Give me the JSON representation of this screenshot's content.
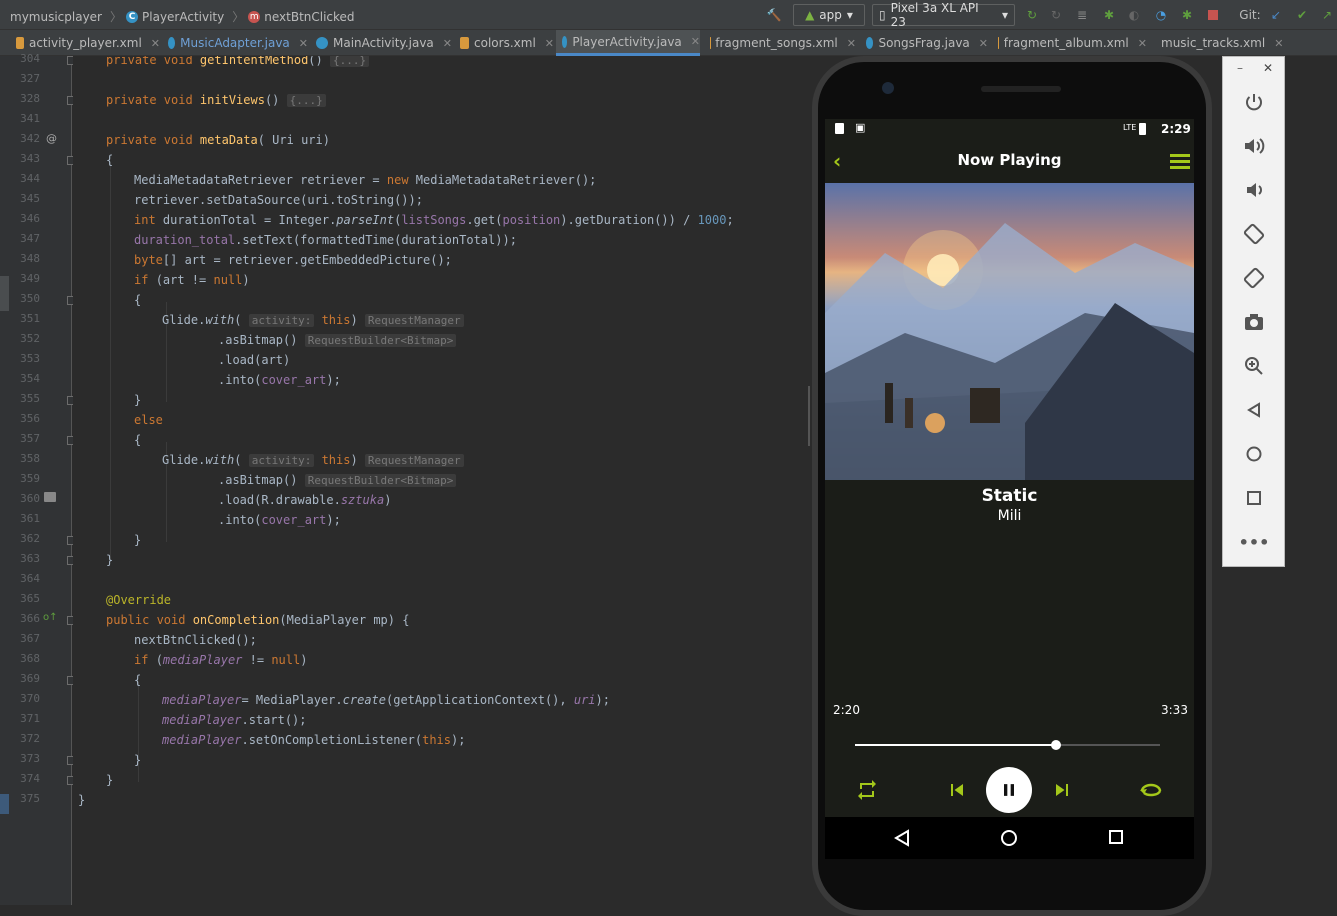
{
  "breadcrumb": {
    "project": "mymusicplayer",
    "class": "PlayerActivity",
    "method": "nextBtnClicked"
  },
  "toolbar": {
    "run_config": "app",
    "device": "Pixel 3a XL API 23",
    "git_label": "Git:"
  },
  "tabs": [
    {
      "label": "activity_player.xml",
      "type": "xml"
    },
    {
      "label": "MusicAdapter.java",
      "type": "java"
    },
    {
      "label": "MainActivity.java",
      "type": "java"
    },
    {
      "label": "colors.xml",
      "type": "xml"
    },
    {
      "label": "PlayerActivity.java",
      "type": "java",
      "active": true
    },
    {
      "label": "fragment_songs.xml",
      "type": "xml"
    },
    {
      "label": "SongsFrag.java",
      "type": "java"
    },
    {
      "label": "fragment_album.xml",
      "type": "xml"
    },
    {
      "label": "music_tracks.xml",
      "type": "xml"
    }
  ],
  "line_numbers": [
    "304",
    "327",
    "328",
    "341",
    "342",
    "343",
    "344",
    "345",
    "346",
    "347",
    "348",
    "349",
    "350",
    "351",
    "352",
    "353",
    "354",
    "355",
    "356",
    "357",
    "358",
    "359",
    "360",
    "361",
    "362",
    "363",
    "364",
    "365",
    "366",
    "367",
    "368",
    "369",
    "370",
    "371",
    "372",
    "373",
    "374",
    "375"
  ],
  "code_lines": [
    "private void getIntentMethod() {...}",
    "",
    "private void initViews() {...}",
    "",
    "private void metaData( Uri uri)",
    "{",
    "MediaMetadataRetriever retriever = new MediaMetadataRetriever();",
    "retriever.setDataSource(uri.toString());",
    "int durationTotal = Integer.parseInt(listSongs.get(position).getDuration()) / 1000;",
    "duration_total.setText(formattedTime(durationTotal));",
    "byte[] art = retriever.getEmbeddedPicture();",
    "if (art != null)",
    "{",
    "Glide.with( activity: this) RequestManager",
    ".asBitmap() RequestBuilder<Bitmap>",
    ".load(art)",
    ".into(cover_art);",
    "}",
    "else",
    "{",
    "Glide.with( activity: this) RequestManager",
    ".asBitmap() RequestBuilder<Bitmap>",
    ".load(R.drawable.sztuka)",
    ".into(cover_art);",
    "}",
    "}",
    "",
    "@Override",
    "public void onCompletion(MediaPlayer mp) {",
    "nextBtnClicked();",
    "if (mediaPlayer != null)",
    "{",
    "mediaPlayer= MediaPlayer.create(getApplicationContext(), uri);",
    "mediaPlayer.start();",
    "mediaPlayer.setOnCompletionListener(this);",
    "}",
    "}",
    "}"
  ],
  "phone": {
    "clock": "2:29",
    "network": "LTE",
    "title": "Now Playing",
    "song_name": "Static",
    "artist": "Mili",
    "time_played": "2:20",
    "time_total": "3:33",
    "progress": 0.66
  },
  "colors": {
    "accent": "#a4c81a",
    "ide_bg": "#2b2b2b",
    "player_bg": "#1b1d18"
  }
}
